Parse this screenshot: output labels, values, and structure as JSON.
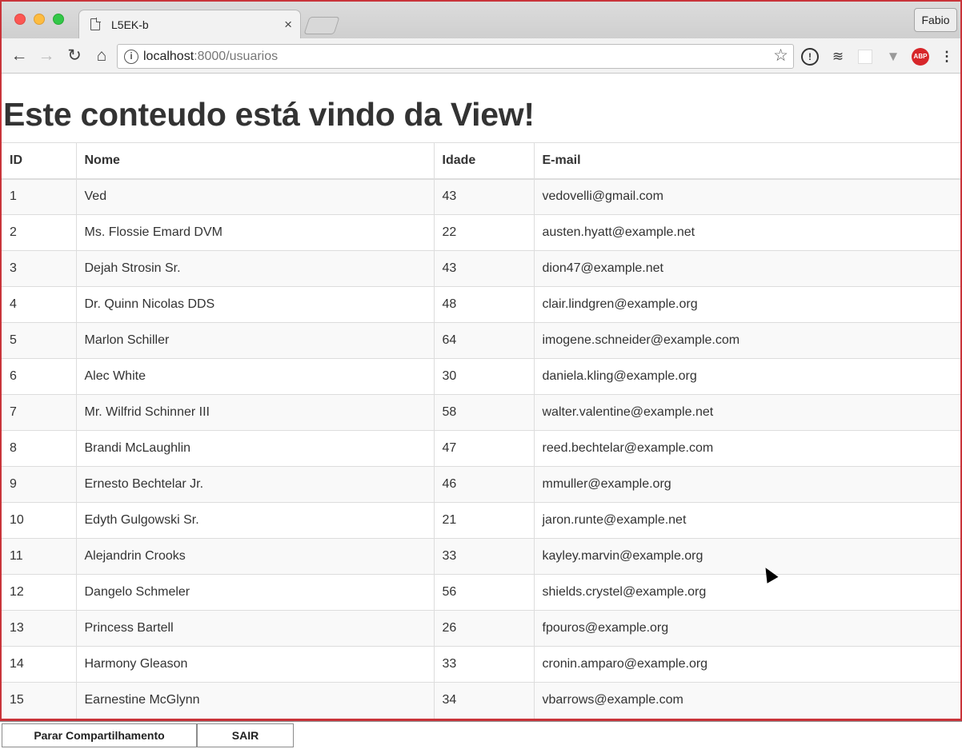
{
  "browser": {
    "tab_title": "L5EK-b",
    "tab_close": "×",
    "profile_name": "Fabio",
    "url_host": "localhost",
    "url_rest": ":8000/usuarios",
    "abp_label": "ABP"
  },
  "page": {
    "heading": "Este conteudo está vindo da View!",
    "table": {
      "headers": [
        "ID",
        "Nome",
        "Idade",
        "E-mail"
      ],
      "rows": [
        [
          "1",
          "Ved",
          "43",
          "vedovelli@gmail.com"
        ],
        [
          "2",
          "Ms. Flossie Emard DVM",
          "22",
          "austen.hyatt@example.net"
        ],
        [
          "3",
          "Dejah Strosin Sr.",
          "43",
          "dion47@example.net"
        ],
        [
          "4",
          "Dr. Quinn Nicolas DDS",
          "48",
          "clair.lindgren@example.org"
        ],
        [
          "5",
          "Marlon Schiller",
          "64",
          "imogene.schneider@example.com"
        ],
        [
          "6",
          "Alec White",
          "30",
          "daniela.kling@example.org"
        ],
        [
          "7",
          "Mr. Wilfrid Schinner III",
          "58",
          "walter.valentine@example.net"
        ],
        [
          "8",
          "Brandi McLaughlin",
          "47",
          "reed.bechtelar@example.com"
        ],
        [
          "9",
          "Ernesto Bechtelar Jr.",
          "46",
          "mmuller@example.org"
        ],
        [
          "10",
          "Edyth Gulgowski Sr.",
          "21",
          "jaron.runte@example.net"
        ],
        [
          "11",
          "Alejandrin Crooks",
          "33",
          "kayley.marvin@example.org"
        ],
        [
          "12",
          "Dangelo Schmeler",
          "56",
          "shields.crystel@example.org"
        ],
        [
          "13",
          "Princess Bartell",
          "26",
          "fpouros@example.org"
        ],
        [
          "14",
          "Harmony Gleason",
          "33",
          "cronin.amparo@example.org"
        ],
        [
          "15",
          "Earnestine McGlynn",
          "34",
          "vbarrows@example.com"
        ]
      ]
    }
  },
  "sharebar": {
    "stop_label": "Parar Compartilhamento",
    "exit_label": "SAIR"
  },
  "colors": {
    "window_border": "#c9343a",
    "abp": "#d7262a"
  }
}
